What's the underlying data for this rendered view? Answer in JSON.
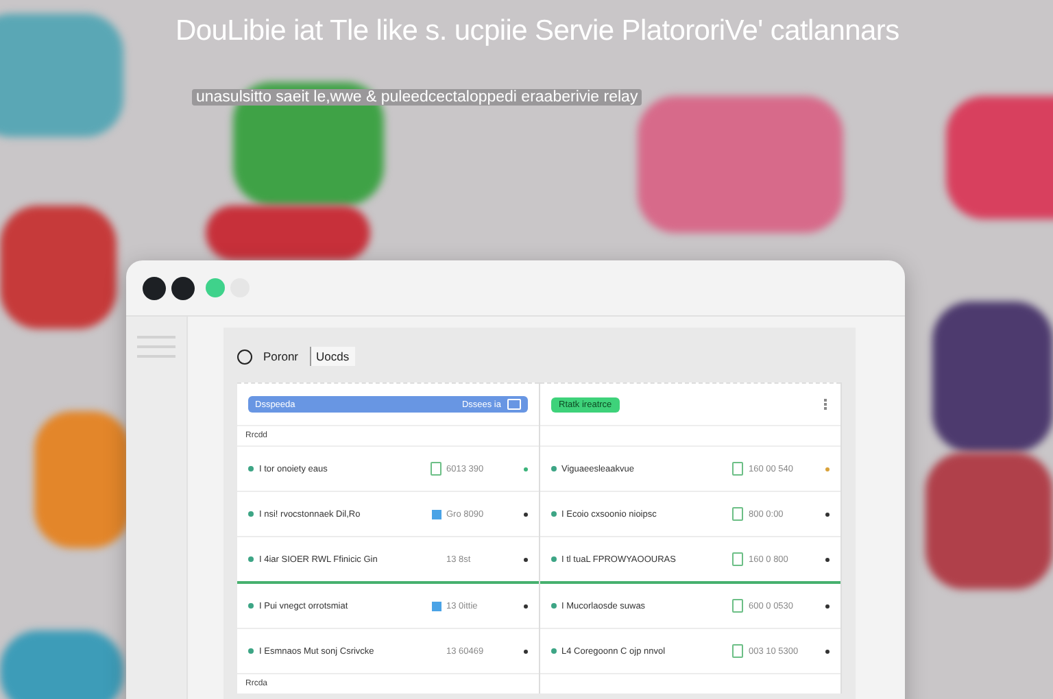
{
  "headline": "DouLibie iat Tle like s. ucpiie Servie PlatororiVe' catlannars",
  "subtitle": "unasulsitto saeit  le,wwe & puleedcectaloppedi eraaberivie relay",
  "window": {
    "controls": [
      {
        "kind": "dark"
      },
      {
        "kind": "dark"
      },
      {
        "kind": "green"
      },
      {
        "kind": "light"
      }
    ],
    "tabs": [
      {
        "label": "Poronr",
        "selected": false
      },
      {
        "label": "Uocds",
        "selected": true
      }
    ],
    "left_panel": {
      "header": {
        "label": "Dsspeeda",
        "action": "Dssees ia"
      },
      "section": "Rrcdd",
      "footer": "Rrcda",
      "rows": [
        {
          "text": "I tor onoiety eaus",
          "time": "6013 390",
          "kind": "doc",
          "color": "#3bb37a",
          "divider_below": false
        },
        {
          "text": "I nsi! rvocstonnaek Dil,Ro",
          "time": "Gro 8090",
          "kind": "square",
          "color": "#333333",
          "divider_below": false
        },
        {
          "text": "I 4iar SIOER RWL Ffinicic Gin",
          "time": "13 8st",
          "kind": "none",
          "color": "#333333",
          "divider_below": true
        },
        {
          "text": "I Pui vnegct orrotsmiat",
          "time": "13 0ittie",
          "kind": "square",
          "color": "#333333",
          "divider_below": false
        },
        {
          "text": "I Esmnaos Mut sonj Csrivcke",
          "time": "13 60469",
          "kind": "none",
          "color": "#333333",
          "divider_below": false
        }
      ]
    },
    "right_panel": {
      "header": {
        "label": "Rtatk ireatrce"
      },
      "rows": [
        {
          "text": "Viguaeesleaakvue",
          "time": "160 00 540",
          "kind": "doc",
          "color": "#d9a23a",
          "divider_below": false
        },
        {
          "text": "I Ecoio cxsoonio nioipsc",
          "time": "800 0:00",
          "kind": "doc",
          "color": "#333333",
          "divider_below": false
        },
        {
          "text": "I tl tuaL FPROWYAOOURAS",
          "time": "160 0 800",
          "kind": "doc",
          "color": "#333333",
          "divider_below": true
        },
        {
          "text": "I Mucorlaosde suwas",
          "time": "600 0 0530",
          "kind": "doc",
          "color": "#333333",
          "divider_below": false
        },
        {
          "text": "L4 Coregoonn C ojp nnvol",
          "time": "003 10 5300",
          "kind": "doc",
          "color": "#333333",
          "divider_below": false
        }
      ]
    }
  }
}
